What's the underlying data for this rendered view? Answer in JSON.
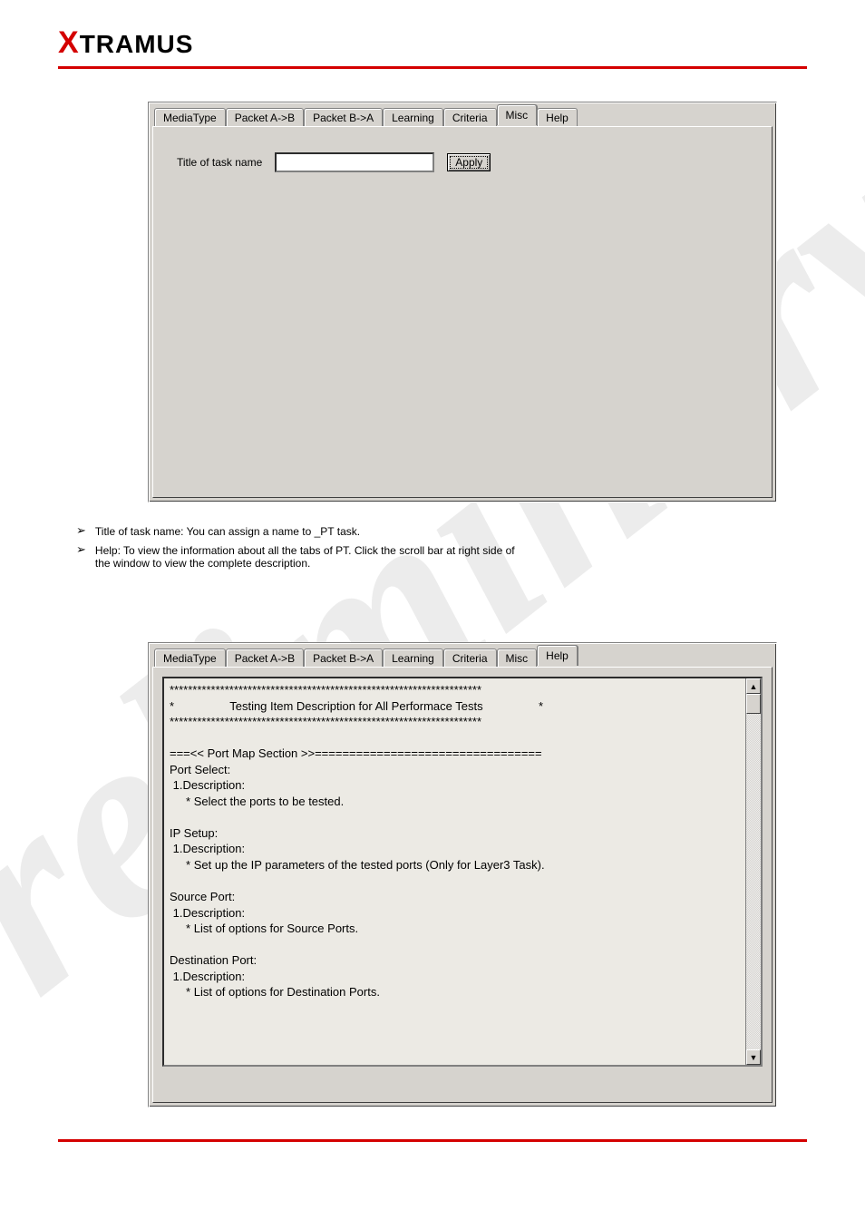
{
  "logo": {
    "prefix": "X",
    "rest": "TRAMUS"
  },
  "panelMisc": {
    "tabs": [
      "MediaType",
      "Packet A->B",
      "Packet B->A",
      "Learning",
      "Criteria",
      "Misc",
      "Help"
    ],
    "activeIndex": 5,
    "label": "Title of task name",
    "inputValue": "",
    "apply": "Apply"
  },
  "interText": {
    "b1": "Title of task name: You can assign a name to _PT task.",
    "b2a": "Help: To view the information about all the tabs of PT. Click the scroll bar at right side of",
    "b2b": "the window to view the complete description."
  },
  "panelHelp": {
    "tabs": [
      "MediaType",
      "Packet A->B",
      "Packet B->A",
      "Learning",
      "Criteria",
      "Misc",
      "Help"
    ],
    "activeIndex": 6,
    "text": "********************************************************************\n*                 Testing Item Description for All Performace Tests                 *\n********************************************************************\n\n===<< Port Map Section >>=================================\nPort Select:\n 1.Description:\n     * Select the ports to be tested.\n\nIP Setup:\n 1.Description:\n     * Set up the IP parameters of the tested ports (Only for Layer3 Task).\n\nSource Port:\n 1.Description:\n     * List of options for Source Ports.\n\nDestination Port:\n 1.Description:\n     * List of options for Destination Ports."
  },
  "footer": {
    "left": "",
    "right": ""
  }
}
